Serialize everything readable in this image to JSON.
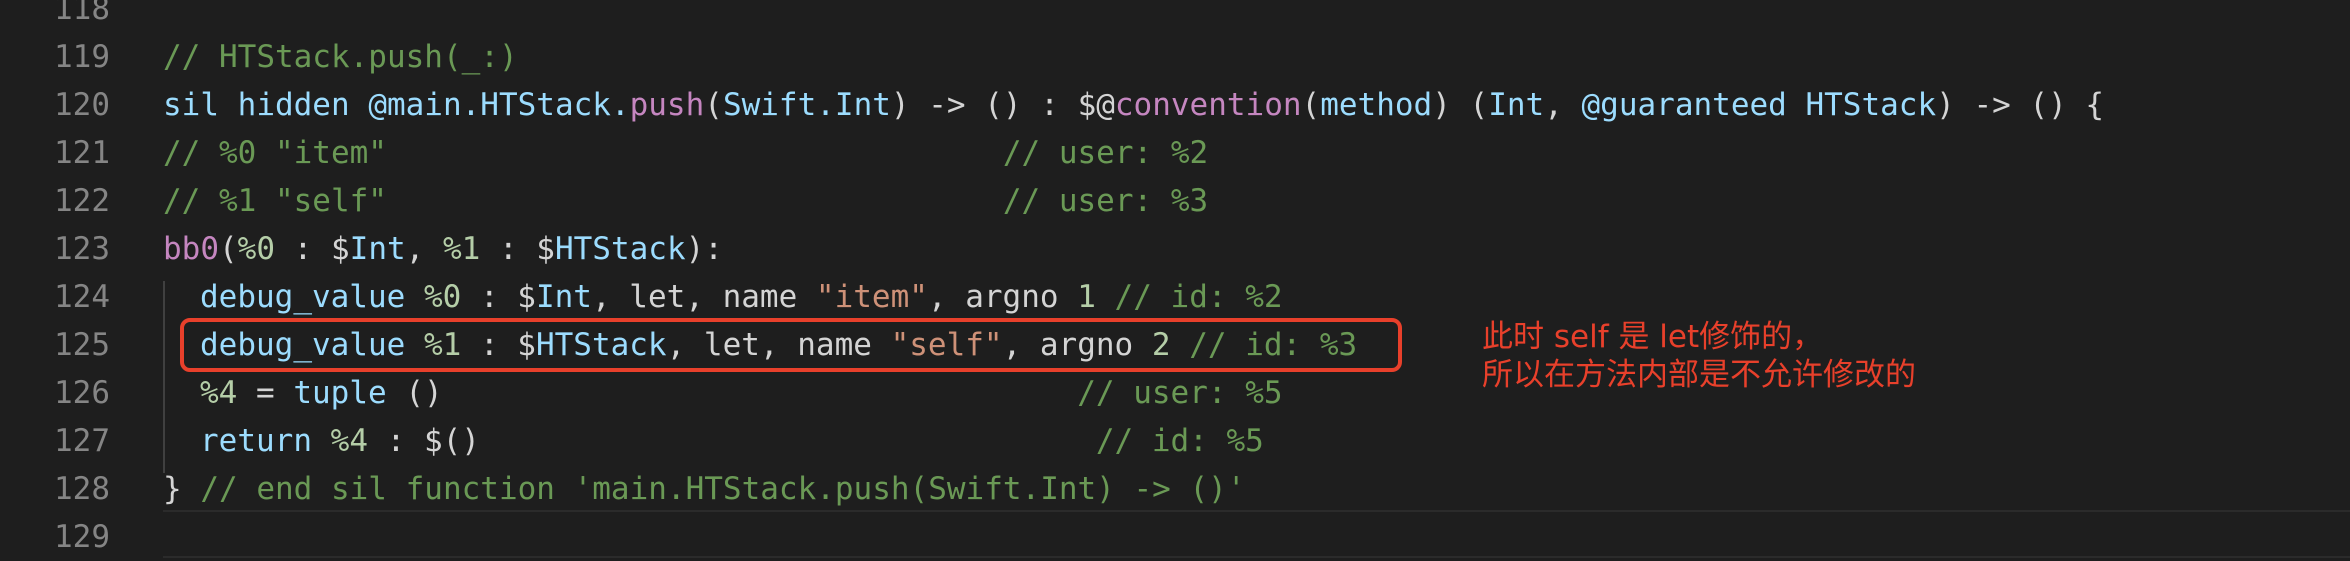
{
  "lines": [
    {
      "num": "118",
      "tokens": []
    },
    {
      "num": "119",
      "tokens": [
        {
          "t": "// HTStack.push(_:)",
          "c": "comment"
        }
      ]
    },
    {
      "num": "120",
      "tokens": [
        {
          "t": "sil hidden ",
          "c": "kw"
        },
        {
          "t": "@main.HTStack.",
          "c": "kw"
        },
        {
          "t": "push",
          "c": "ctrl"
        },
        {
          "t": "(",
          "c": "plain"
        },
        {
          "t": "Swift.Int",
          "c": "kw"
        },
        {
          "t": ") -> () : ",
          "c": "plain"
        },
        {
          "t": "$@",
          "c": "plain"
        },
        {
          "t": "convention",
          "c": "ctrl"
        },
        {
          "t": "(",
          "c": "plain"
        },
        {
          "t": "method",
          "c": "kw"
        },
        {
          "t": ") (",
          "c": "plain"
        },
        {
          "t": "Int",
          "c": "kw"
        },
        {
          "t": ", ",
          "c": "plain"
        },
        {
          "t": "@guaranteed HTStack",
          "c": "kw"
        },
        {
          "t": ") -> () {",
          "c": "plain"
        }
      ]
    },
    {
      "num": "121",
      "tokens": [
        {
          "t": "// %0 \"item\"                                 // user: %2",
          "c": "comment"
        }
      ]
    },
    {
      "num": "122",
      "tokens": [
        {
          "t": "// %1 \"self\"                                 // user: %3",
          "c": "comment"
        }
      ]
    },
    {
      "num": "123",
      "tokens": [
        {
          "t": "bb0",
          "c": "ctrl"
        },
        {
          "t": "(",
          "c": "plain"
        },
        {
          "t": "%0",
          "c": "num"
        },
        {
          "t": " : $",
          "c": "plain"
        },
        {
          "t": "Int",
          "c": "kw"
        },
        {
          "t": ", ",
          "c": "plain"
        },
        {
          "t": "%1",
          "c": "num"
        },
        {
          "t": " : $",
          "c": "plain"
        },
        {
          "t": "HTStack",
          "c": "kw"
        },
        {
          "t": "):",
          "c": "plain"
        }
      ]
    },
    {
      "num": "124",
      "indent": true,
      "tokens": [
        {
          "t": "debug_value ",
          "c": "kw"
        },
        {
          "t": "%0",
          "c": "num"
        },
        {
          "t": " : $",
          "c": "plain"
        },
        {
          "t": "Int",
          "c": "kw"
        },
        {
          "t": ", let, name ",
          "c": "plain"
        },
        {
          "t": "\"item\"",
          "c": "str"
        },
        {
          "t": ", argno ",
          "c": "plain"
        },
        {
          "t": "1",
          "c": "num"
        },
        {
          "t": " // id: %2",
          "c": "comment"
        }
      ]
    },
    {
      "num": "125",
      "indent": true,
      "tokens": [
        {
          "t": "debug_value ",
          "c": "kw"
        },
        {
          "t": "%1",
          "c": "num"
        },
        {
          "t": " : $",
          "c": "plain"
        },
        {
          "t": "HTStack",
          "c": "kw"
        },
        {
          "t": ", let, name ",
          "c": "plain"
        },
        {
          "t": "\"self\"",
          "c": "str"
        },
        {
          "t": ", argno ",
          "c": "plain"
        },
        {
          "t": "2",
          "c": "num"
        },
        {
          "t": " // id: %3",
          "c": "comment"
        }
      ]
    },
    {
      "num": "126",
      "indent": true,
      "tokens": [
        {
          "t": "%4",
          "c": "num"
        },
        {
          "t": " = ",
          "c": "plain"
        },
        {
          "t": "tuple",
          "c": "kw"
        },
        {
          "t": " ()",
          "c": "plain"
        },
        {
          "t": "                                  // user: %5",
          "c": "comment"
        }
      ]
    },
    {
      "num": "127",
      "indent": true,
      "tokens": [
        {
          "t": "return ",
          "c": "kw"
        },
        {
          "t": "%4",
          "c": "num"
        },
        {
          "t": " : $()",
          "c": "plain"
        },
        {
          "t": "                                 // id: %5",
          "c": "comment"
        }
      ]
    },
    {
      "num": "128",
      "tokens": [
        {
          "t": "} ",
          "c": "plain"
        },
        {
          "t": "// end sil function 'main.HTStack.push(Swift.Int) -> ()'",
          "c": "comment"
        }
      ]
    },
    {
      "num": "129",
      "tokens": []
    }
  ],
  "annotation": {
    "line1": "此时 self 是 let修饰的，",
    "line2": "所以在方法内部是不允许修改的"
  },
  "colors": {
    "background": "#1e1e1e",
    "annotation": "#e8402b",
    "comment": "#6a9955",
    "keyword": "#9cdcfe",
    "string": "#ce9178",
    "number": "#b5cea8",
    "control": "#c586c0"
  }
}
